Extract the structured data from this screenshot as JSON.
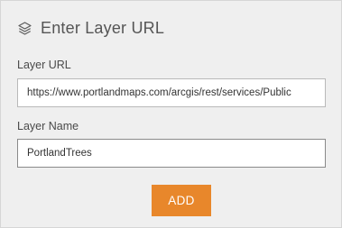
{
  "dialog": {
    "title": "Enter Layer URL",
    "title_icon": "layers-icon"
  },
  "form": {
    "url_label": "Layer URL",
    "url_value": "https://www.portlandmaps.com/arcgis/rest/services/Public",
    "name_label": "Layer Name",
    "name_value": "PortlandTrees",
    "add_label": "ADD"
  },
  "colors": {
    "panel_background": "#efefef",
    "button_accent": "#e8872b",
    "text": "#4c4c4c"
  }
}
